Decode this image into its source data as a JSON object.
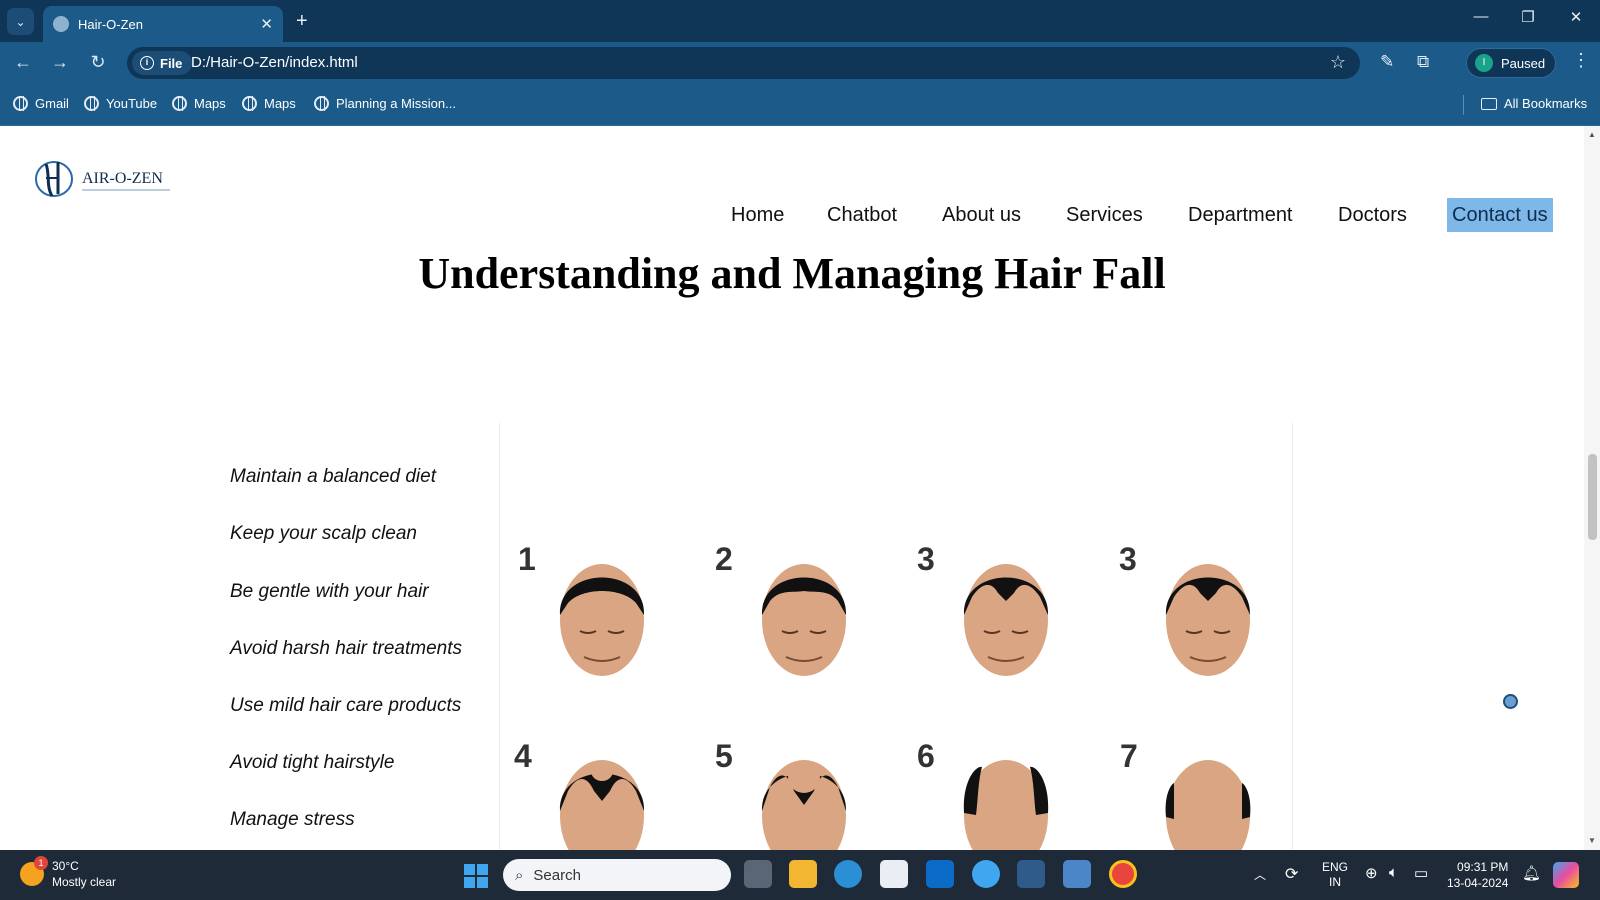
{
  "browser": {
    "tab_title": "Hair-O-Zen",
    "address_chip": "File",
    "url": "D:/Hair-O-Zen/index.html",
    "profile_label": "Paused",
    "profile_initial": "I",
    "bookmarks": [
      "Gmail",
      "YouTube",
      "Maps",
      "Maps",
      "Planning a Mission..."
    ],
    "all_bookmarks": "All Bookmarks"
  },
  "site": {
    "logo_text": "AIR-O-ZEN",
    "nav": [
      "Home",
      "Chatbot",
      "About us",
      "Services",
      "Department",
      "Doctors",
      "Contact us"
    ],
    "active_nav": "Contact us",
    "headline": "Understanding and Managing Hair Fall",
    "tips": [
      "Maintain a balanced diet",
      "Keep your scalp clean",
      "Be gentle with your hair",
      "Avoid harsh hair treatments",
      "Use mild hair care products",
      "Avoid tight hairstyle",
      "Manage stress"
    ],
    "stage_labels": [
      "1",
      "2",
      "3",
      "3",
      "4",
      "5",
      "6",
      "7"
    ]
  },
  "taskbar": {
    "temperature": "30°C",
    "weather": "Mostly clear",
    "weather_badge": "1",
    "search_placeholder": "Search",
    "lang_top": "ENG",
    "lang_bottom": "IN",
    "time": "09:31 PM",
    "date": "13-04-2024"
  },
  "colors": {
    "tab_bar": "#0f3557",
    "toolbar": "#1c5a8a",
    "nav_active": "#7db8e8",
    "taskbar": "#1e2a38"
  }
}
